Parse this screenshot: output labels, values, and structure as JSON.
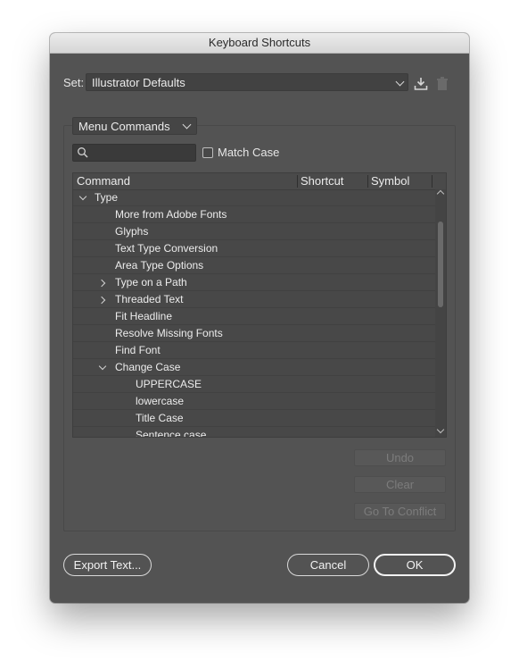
{
  "window": {
    "title": "Keyboard Shortcuts"
  },
  "set": {
    "label": "Set:",
    "value": "Illustrator Defaults"
  },
  "filter": {
    "category": "Menu Commands",
    "search_placeholder": "",
    "match_case_label": "Match Case",
    "match_case_checked": false
  },
  "table": {
    "columns": [
      "Command",
      "Shortcut",
      "Symbol"
    ],
    "rows": [
      {
        "text": "Type",
        "level": 0,
        "chevron": "down"
      },
      {
        "text": "More from Adobe Fonts",
        "level": 1,
        "chevron": ""
      },
      {
        "text": "Glyphs",
        "level": 1,
        "chevron": ""
      },
      {
        "text": "Text Type Conversion",
        "level": 1,
        "chevron": ""
      },
      {
        "text": "Area Type Options",
        "level": 1,
        "chevron": ""
      },
      {
        "text": "Type on a Path",
        "level": 1,
        "chevron": "right"
      },
      {
        "text": "Threaded Text",
        "level": 1,
        "chevron": "right"
      },
      {
        "text": "Fit Headline",
        "level": 1,
        "chevron": ""
      },
      {
        "text": "Resolve Missing Fonts",
        "level": 1,
        "chevron": ""
      },
      {
        "text": "Find Font",
        "level": 1,
        "chevron": ""
      },
      {
        "text": "Change Case",
        "level": 1,
        "chevron": "down"
      },
      {
        "text": "UPPERCASE",
        "level": 2,
        "chevron": ""
      },
      {
        "text": "lowercase",
        "level": 2,
        "chevron": ""
      },
      {
        "text": "Title Case",
        "level": 2,
        "chevron": ""
      },
      {
        "text": "Sentence case",
        "level": 2,
        "chevron": ""
      }
    ]
  },
  "actions": {
    "undo": "Undo",
    "clear": "Clear",
    "go_to_conflict": "Go To Conflict"
  },
  "footer": {
    "export": "Export Text...",
    "cancel": "Cancel",
    "ok": "OK"
  },
  "icons": {
    "save": "save-set-icon",
    "delete": "trash-icon",
    "search": "magnifier-icon"
  }
}
